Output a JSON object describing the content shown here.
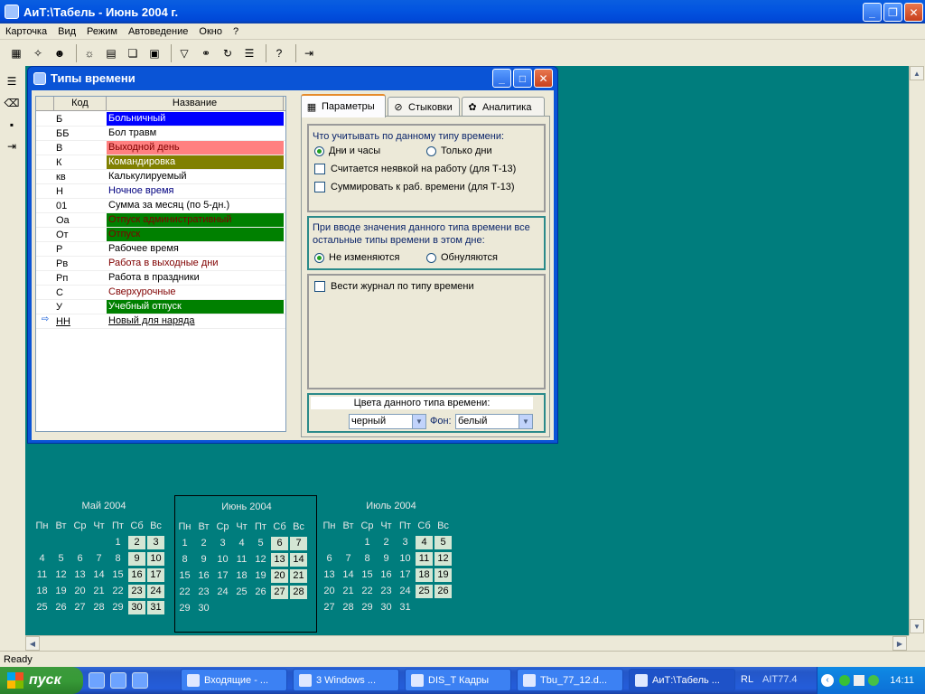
{
  "app": {
    "title": "АиТ:\\Табель - Июнь 2004 г."
  },
  "menu": [
    "Карточка",
    "Вид",
    "Режим",
    "Автоведение",
    "Окно",
    "?"
  ],
  "status": "Ready",
  "window": {
    "title": "Типы времени",
    "grid": {
      "headers": [
        "Код",
        "Название"
      ],
      "rows": [
        {
          "code": "Б",
          "name": "Больничный",
          "bg": "#0000ff",
          "fg": "#ffffff"
        },
        {
          "code": "ББ",
          "name": "Бол травм",
          "bg": "#ffffff",
          "fg": "#000000"
        },
        {
          "code": "В",
          "name": "Выходной день",
          "bg": "#ff8080",
          "fg": "#800000"
        },
        {
          "code": "К",
          "name": "Командировка",
          "bg": "#808000",
          "fg": "#ffffff"
        },
        {
          "code": "кв",
          "name": "Калькулируемый",
          "bg": "#ffffff",
          "fg": "#000000"
        },
        {
          "code": "Н",
          "name": "Ночное время",
          "bg": "#ffffff",
          "fg": "#000080"
        },
        {
          "code": "01",
          "name": "Сумма за месяц (по 5-дн.)",
          "bg": "#ffffff",
          "fg": "#000000"
        },
        {
          "code": "Оа",
          "name": "Отпуск административный",
          "bg": "#008000",
          "fg": "#800000"
        },
        {
          "code": "От",
          "name": "Отпуск",
          "bg": "#008000",
          "fg": "#800000"
        },
        {
          "code": "Р",
          "name": "Рабочее время",
          "bg": "#ffffff",
          "fg": "#000000"
        },
        {
          "code": "Рв",
          "name": "Работа в выходные дни",
          "bg": "#ffffff",
          "fg": "#800000"
        },
        {
          "code": "Рп",
          "name": "Работа в праздники",
          "bg": "#ffffff",
          "fg": "#000000"
        },
        {
          "code": "С",
          "name": "Сверхурочные",
          "bg": "#ffffff",
          "fg": "#800000"
        },
        {
          "code": "У",
          "name": "Учебный отпуск",
          "bg": "#008000",
          "fg": "#ffffff"
        },
        {
          "code": "НН",
          "name": "Новый для наряда",
          "bg": "#ffffff",
          "fg": "#000000"
        }
      ]
    },
    "tabs": [
      "Параметры",
      "Стыковки",
      "Аналитика"
    ],
    "params": {
      "group1_label": "Что учитывать по данному типу времени:",
      "radio_days_hours": "Дни и часы",
      "radio_days_only": "Только дни",
      "chk_absence": "Считается неявкой на работу (для Т-13)",
      "chk_sum": "Суммировать к раб. времени (для Т-13)",
      "group2_label": "При вводе значения данного типа времени все остальные типы времени в этом дне:",
      "radio_no_change": "Не изменяются",
      "radio_reset": "Обнуляются",
      "chk_journal": "Вести журнал по типу времени",
      "colors_label": "Цвета данного типа времени:",
      "color_value": "черный",
      "bg_label": "Фон:",
      "bg_value": "белый"
    }
  },
  "calendars": [
    {
      "title": "Май 2004",
      "dow": [
        "Пн",
        "Вт",
        "Ср",
        "Чт",
        "Пт",
        "Сб",
        "Вс"
      ],
      "start": 5,
      "days": 31
    },
    {
      "title": "Июнь 2004",
      "dow": [
        "Пн",
        "Вт",
        "Ср",
        "Чт",
        "Пт",
        "Сб",
        "Вс"
      ],
      "start": 1,
      "days": 30
    },
    {
      "title": "Июль 2004",
      "dow": [
        "Пн",
        "Вт",
        "Ср",
        "Чт",
        "Пт",
        "Сб",
        "Вс"
      ],
      "start": 3,
      "days": 31
    }
  ],
  "taskbar": {
    "start": "пуск",
    "tasks": [
      "Входящие - ...",
      "3 Windows ...",
      "DIS_T Кадры",
      "Tbu_77_12.d...",
      "АиТ:\\Табель ..."
    ],
    "tray_lang": "RL",
    "tray_text": "AIT77.4",
    "clock": "14:11"
  }
}
